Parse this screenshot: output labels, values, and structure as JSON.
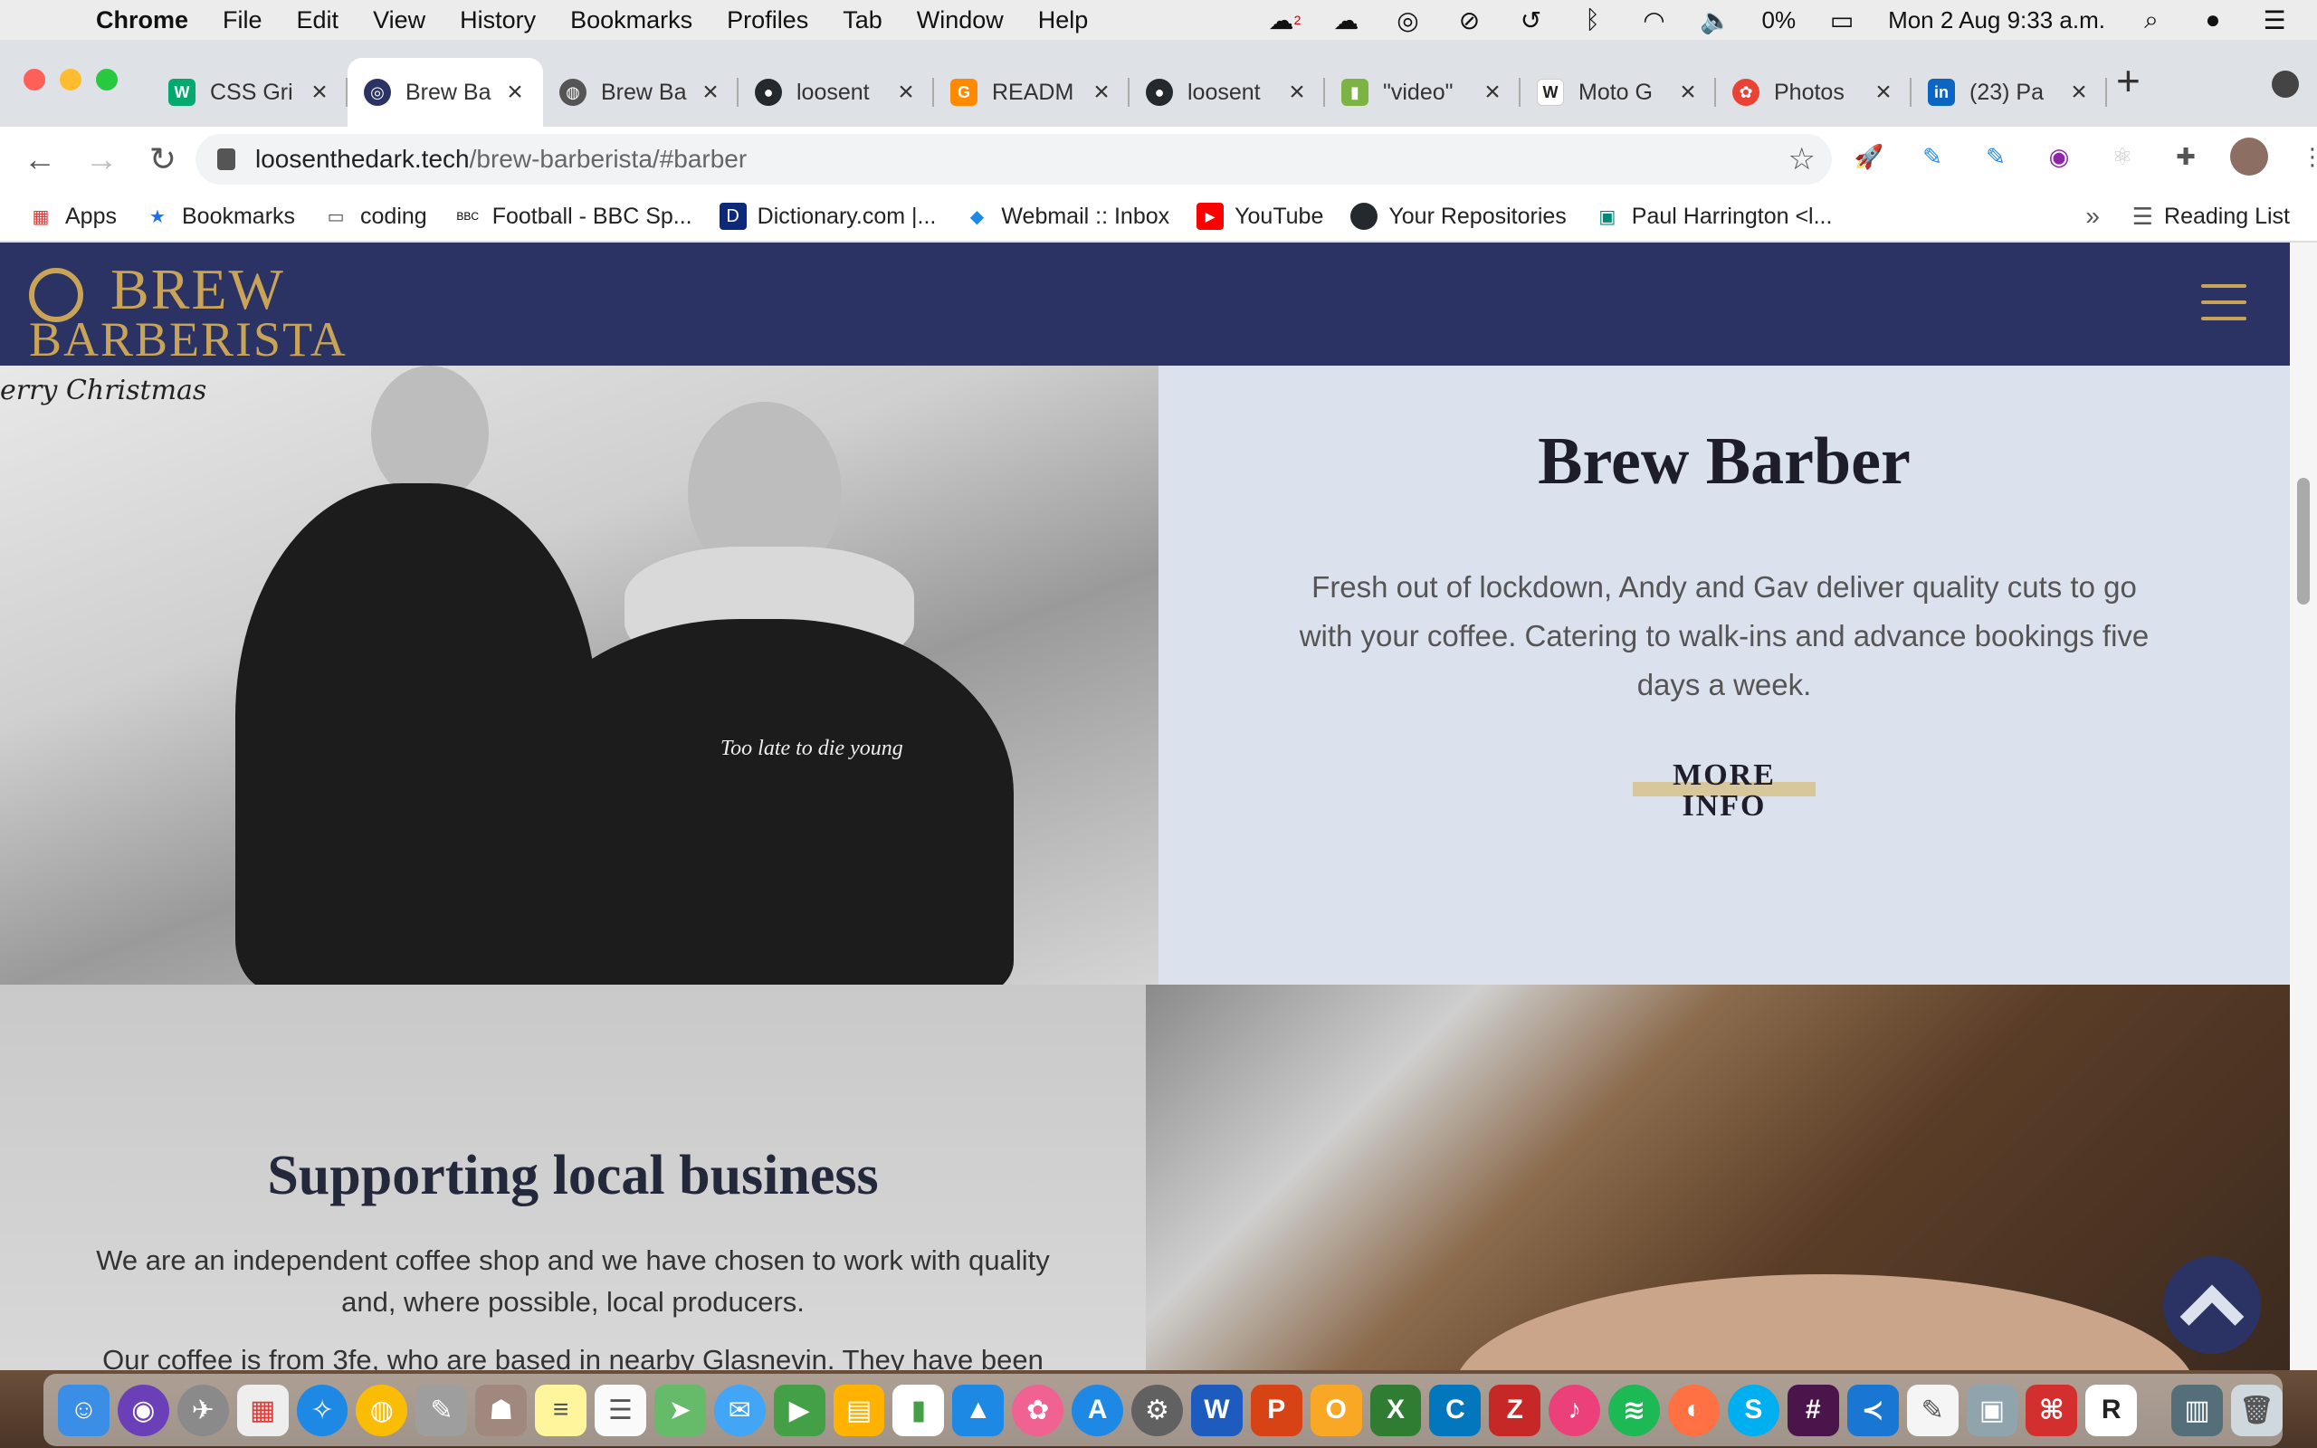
{
  "menubar": {
    "app": "Chrome",
    "items": [
      "File",
      "Edit",
      "View",
      "History",
      "Bookmarks",
      "Profiles",
      "Tab",
      "Window",
      "Help"
    ],
    "battery": "0%",
    "clock": "Mon 2 Aug  9:33 a.m.",
    "badge": "2"
  },
  "tabs": [
    {
      "title": "CSS Gri",
      "icon": "w3schools-icon",
      "color": "#04aa6d"
    },
    {
      "title": "Brew Ba",
      "icon": "brew-logo-icon",
      "color": "#2b3364"
    },
    {
      "title": "Brew Ba",
      "icon": "globe-icon",
      "color": "#555555"
    },
    {
      "title": "loosent",
      "icon": "github-icon",
      "color": "#24292e"
    },
    {
      "title": "READM",
      "icon": "gitpod-icon",
      "color": "#ff8a00"
    },
    {
      "title": "loosent",
      "icon": "github-icon",
      "color": "#24292e"
    },
    {
      "title": "\"video\"",
      "icon": "chart-icon",
      "color": "#7cb342"
    },
    {
      "title": "Moto G",
      "icon": "wikipedia-icon",
      "color": "#333333"
    },
    {
      "title": "Photos",
      "icon": "google-photos-icon",
      "color": "#ea4335"
    },
    {
      "title": "(23) Pa",
      "icon": "linkedin-icon",
      "color": "#0a66c2"
    }
  ],
  "address": {
    "host": "loosenthedark.tech",
    "path": "/brew-barberista/#barber"
  },
  "bookmarks": [
    {
      "label": "Apps",
      "icon": "apps-grid-icon"
    },
    {
      "label": "Bookmarks",
      "icon": "star-icon"
    },
    {
      "label": "coding",
      "icon": "folder-icon"
    },
    {
      "label": "Football - BBC Sp...",
      "icon": "bbc-icon"
    },
    {
      "label": "Dictionary.com |...",
      "icon": "dictionary-icon"
    },
    {
      "label": "Webmail :: Inbox",
      "icon": "webmail-icon"
    },
    {
      "label": "YouTube",
      "icon": "youtube-icon"
    },
    {
      "label": "Your Repositories",
      "icon": "github-icon"
    },
    {
      "label": "Paul Harrington <l...",
      "icon": "mail-icon"
    }
  ],
  "reading_list": "Reading List",
  "site": {
    "logo_top": "BREW",
    "logo_bottom": "BARBERISTA",
    "barber": {
      "heading": "Brew Barber",
      "body": "Fresh out of lockdown, Andy and Gav deliver quality cuts to go with your coffee. Catering to walk-ins and advance bookings five days a week.",
      "cta": "MORE INFO"
    },
    "local": {
      "heading": "Supporting local business",
      "p1": "We are an independent coffee shop and we have chosen to work with quality and, where possible, local producers.",
      "p2": "Our coffee is from 3fe, who are based in nearby Glasnevin. They have been"
    },
    "photo_text": "Too late to die young",
    "sign_text": "erry  Christmas"
  },
  "colors": {
    "navy": "#2b3364",
    "gold": "#c9a457",
    "panel": "#dce1ee"
  }
}
